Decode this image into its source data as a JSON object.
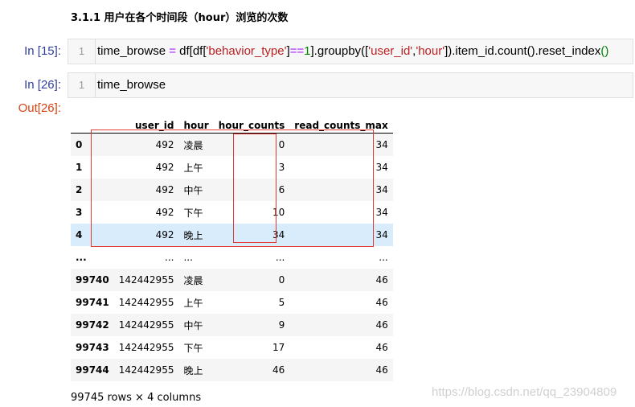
{
  "heading": "3.1.1  用户在各个时间段（hour）浏览的次数",
  "cells": [
    {
      "prompt": "In [15]:",
      "line_number": "1",
      "code": {
        "p1": "time_browse ",
        "eq": "=",
        "p2": " df[df[",
        "s1": "'behavior_type'",
        "p3": "]",
        "op": "==",
        "num": "1",
        "p4": "].groupby([",
        "s2": "'user_id'",
        "p5": ",",
        "s3": "'hour'",
        "p6": "]).item_id.count().reset_index",
        "paren": "()"
      }
    },
    {
      "prompt": "In [26]:",
      "line_number": "1",
      "code_text": "time_browse"
    }
  ],
  "output_prompt": "Out[26]:",
  "table": {
    "columns": [
      "",
      "user_id",
      "hour",
      "hour_counts",
      "read_counts_max"
    ],
    "rows": [
      [
        "0",
        "492",
        "凌晨",
        "0",
        "34"
      ],
      [
        "1",
        "492",
        "上午",
        "3",
        "34"
      ],
      [
        "2",
        "492",
        "中午",
        "6",
        "34"
      ],
      [
        "3",
        "492",
        "下午",
        "10",
        "34"
      ],
      [
        "4",
        "492",
        "晚上",
        "34",
        "34"
      ],
      [
        "...",
        "...",
        "...",
        "...",
        "..."
      ],
      [
        "99740",
        "142442955",
        "凌晨",
        "0",
        "46"
      ],
      [
        "99741",
        "142442955",
        "上午",
        "5",
        "46"
      ],
      [
        "99742",
        "142442955",
        "中午",
        "9",
        "46"
      ],
      [
        "99743",
        "142442955",
        "下午",
        "17",
        "46"
      ],
      [
        "99744",
        "142442955",
        "晚上",
        "46",
        "46"
      ]
    ]
  },
  "footer": "99745 rows × 4 columns",
  "watermark": "https://blog.csdn.net/qq_23904809"
}
